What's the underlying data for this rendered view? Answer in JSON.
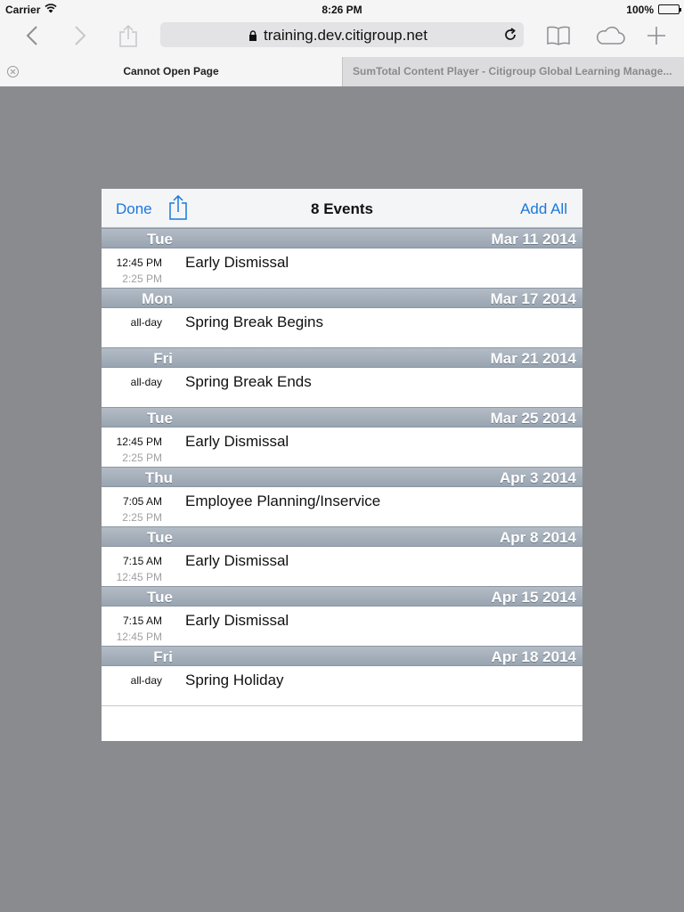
{
  "status_bar": {
    "carrier": "Carrier",
    "time": "8:26 PM",
    "battery": "100%"
  },
  "browser": {
    "url": "training.dev.citigroup.net",
    "tabs": [
      {
        "title": "Cannot Open Page",
        "active": true
      },
      {
        "title": "SumTotal Content Player - Citigroup Global Learning Manage...",
        "active": false
      }
    ]
  },
  "modal": {
    "done_label": "Done",
    "title": "8 Events",
    "add_all_label": "Add All",
    "days": [
      {
        "weekday": "Tue",
        "date": "Mar 11 2014",
        "start": "12:45 PM",
        "end": "2:25 PM",
        "name": "Early Dismissal"
      },
      {
        "weekday": "Mon",
        "date": "Mar 17 2014",
        "start": "all-day",
        "end": "",
        "name": "Spring Break Begins"
      },
      {
        "weekday": "Fri",
        "date": "Mar 21 2014",
        "start": "all-day",
        "end": "",
        "name": "Spring Break Ends"
      },
      {
        "weekday": "Tue",
        "date": "Mar 25 2014",
        "start": "12:45 PM",
        "end": "2:25 PM",
        "name": "Early Dismissal"
      },
      {
        "weekday": "Thu",
        "date": "Apr 3 2014",
        "start": "7:05 AM",
        "end": "2:25 PM",
        "name": "Employee Planning/Inservice"
      },
      {
        "weekday": "Tue",
        "date": "Apr 8 2014",
        "start": "7:15 AM",
        "end": "12:45 PM",
        "name": "Early Dismissal"
      },
      {
        "weekday": "Tue",
        "date": "Apr 15 2014",
        "start": "7:15 AM",
        "end": "12:45 PM",
        "name": "Early Dismissal"
      },
      {
        "weekday": "Fri",
        "date": "Apr 18 2014",
        "start": "all-day",
        "end": "",
        "name": "Spring Holiday"
      }
    ]
  },
  "colors": {
    "accent": "#1a78dc",
    "overlay": "#8a8b8f",
    "section_header": "#a3adb8"
  },
  "icons": [
    "wifi-icon",
    "battery-icon",
    "back-icon",
    "forward-icon",
    "share-icon",
    "lock-icon",
    "reload-icon",
    "bookmarks-icon",
    "icloud-tabs-icon",
    "new-tab-icon",
    "close-tab-icon"
  ]
}
